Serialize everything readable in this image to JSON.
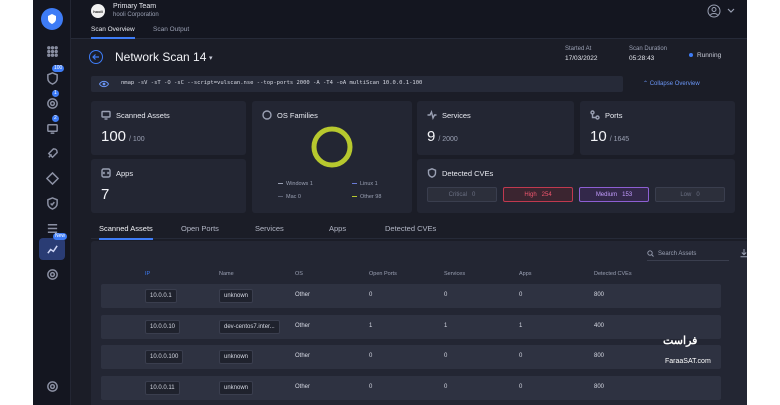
{
  "team": {
    "logo_text": "hooli",
    "name": "Primary Team",
    "org": "hooli Corporation"
  },
  "top_tabs": [
    "Scan Overview",
    "Scan Output"
  ],
  "sidebar": {
    "badges": {
      "b1": "100",
      "b2": "1",
      "b3": "2",
      "new": "New"
    }
  },
  "header": {
    "title": "Network Scan 14",
    "started_label": "Started At",
    "started_value": "17/03/2022",
    "duration_label": "Scan Duration",
    "duration_value": "05:28:43",
    "status": "Running"
  },
  "command": "nmap -sV -sT -O -sC --script=vulscan.nse --top-ports 2000 -A -T4 -oA multiScan 10.0.0.1-100",
  "collapse_label": "Collapse Overview",
  "cards": {
    "scanned_assets": {
      "title": "Scanned Assets",
      "value": "100",
      "of": "/ 100"
    },
    "apps": {
      "title": "Apps",
      "value": "7"
    },
    "os_families": {
      "title": "OS Families",
      "legend": [
        {
          "label": "Windows 1",
          "color": "#9aa0b3"
        },
        {
          "label": "Linux 1",
          "color": "#6a7bd8"
        },
        {
          "label": "Mac 0",
          "color": "#5b6073"
        },
        {
          "label": "Other 98",
          "color": "#b7c82e"
        }
      ],
      "values": {
        "windows": 1,
        "linux": 1,
        "mac": 0,
        "other": 98
      }
    },
    "services": {
      "title": "Services",
      "value": "9",
      "of": "/ 2000"
    },
    "ports": {
      "title": "Ports",
      "value": "10",
      "of": "/ 1645"
    },
    "cves": {
      "title": "Detected CVEs",
      "chips": [
        {
          "label": "Critical",
          "count": "0"
        },
        {
          "label": "High",
          "count": "254"
        },
        {
          "label": "Medium",
          "count": "153"
        },
        {
          "label": "Low",
          "count": "0"
        }
      ]
    }
  },
  "tabs2": [
    "Scanned Assets",
    "Open Ports",
    "Services",
    "Apps",
    "Detected CVEs"
  ],
  "table": {
    "search_placeholder": "Search Assets",
    "headers": [
      "IP",
      "Name",
      "OS",
      "Open Ports",
      "Services",
      "Apps",
      "Detected CVEs"
    ],
    "rows": [
      [
        "10.0.0.1",
        "unknown",
        "Other",
        "0",
        "0",
        "0",
        "800"
      ],
      [
        "10.0.0.10",
        "dev-centos7.inter...",
        "Other",
        "1",
        "1",
        "1",
        "400"
      ],
      [
        "10.0.0.100",
        "unknown",
        "Other",
        "0",
        "0",
        "0",
        "800"
      ],
      [
        "10.0.0.11",
        "unknown",
        "Other",
        "0",
        "0",
        "0",
        "800"
      ]
    ]
  },
  "watermark": {
    "text": "فراست",
    "sub": "FaraaSAT.com"
  }
}
